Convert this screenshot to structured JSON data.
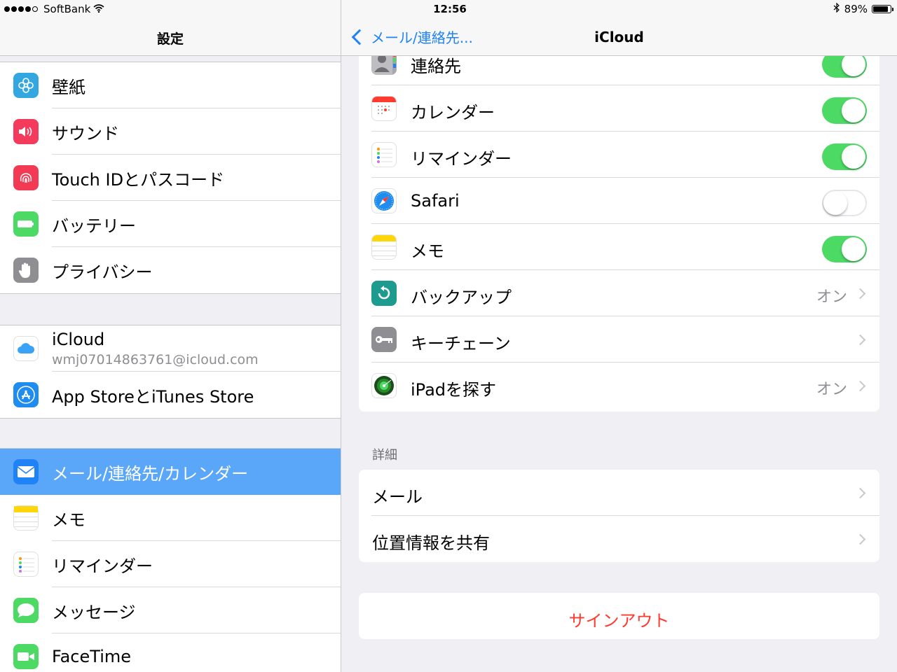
{
  "status": {
    "carrier": "SoftBank",
    "time": "12:56",
    "battery_pct": "89%",
    "battery_level": 0.89
  },
  "master": {
    "title": "設定",
    "groups": [
      {
        "items": [
          {
            "label": "壁紙",
            "icon": "wallpaper-icon",
            "color": "#35a7e0"
          },
          {
            "label": "サウンド",
            "icon": "sound-icon",
            "color": "#f43a5d"
          },
          {
            "label": "Touch IDとパスコード",
            "icon": "fingerprint-icon",
            "color": "#f23a54"
          },
          {
            "label": "バッテリー",
            "icon": "battery-icon",
            "color": "#4cd964"
          },
          {
            "label": "プライバシー",
            "icon": "hand-icon",
            "color": "#8e8e93"
          }
        ]
      },
      {
        "icloud": {
          "label": "iCloud",
          "sub": "wmj07014863761@icloud.com"
        },
        "appstore": {
          "label": "App StoreとiTunes Store"
        }
      },
      {
        "items": [
          {
            "label": "メール/連絡先/カレンダー",
            "icon": "mail-icon",
            "color": "#1f82f7",
            "selected": true
          },
          {
            "label": "メモ",
            "icon": "notes-icon",
            "color": "#ffd60a"
          },
          {
            "label": "リマインダー",
            "icon": "reminders-icon",
            "color": "#ffffff"
          },
          {
            "label": "メッセージ",
            "icon": "messages-icon",
            "color": "#4cd964"
          },
          {
            "label": "FaceTime",
            "icon": "facetime-icon",
            "color": "#4cd964"
          }
        ]
      }
    ]
  },
  "detail": {
    "back_label": "メール/連絡先...",
    "title": "iCloud",
    "services": [
      {
        "label": "連絡先",
        "state": "on"
      },
      {
        "label": "カレンダー",
        "state": "on"
      },
      {
        "label": "リマインダー",
        "state": "on"
      },
      {
        "label": "Safari",
        "state": "off"
      },
      {
        "label": "メモ",
        "state": "on"
      },
      {
        "label": "バックアップ",
        "value": "オン"
      },
      {
        "label": "キーチェーン",
        "value": ""
      },
      {
        "label": "iPadを探す",
        "value": "オン"
      }
    ],
    "advanced_title": "詳細",
    "advanced": [
      {
        "label": "メール"
      },
      {
        "label": "位置情報を共有"
      }
    ],
    "signout_label": "サインアウト"
  }
}
